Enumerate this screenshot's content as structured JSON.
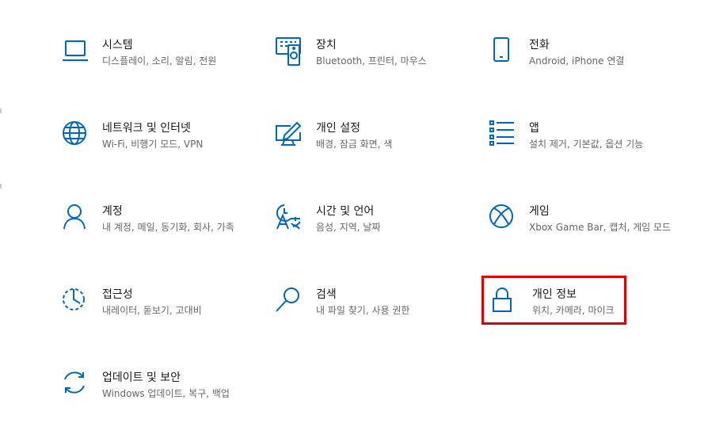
{
  "accent": "#0067c0",
  "highlight_color": "#e00000",
  "tiles": [
    {
      "title": "시스템",
      "desc": "디스플레이, 소리, 알림, 전원",
      "icon": "laptop-icon"
    },
    {
      "title": "장치",
      "desc": "Bluetooth, 프린터, 마우스",
      "icon": "devices-icon"
    },
    {
      "title": "전화",
      "desc": "Android, iPhone 연결",
      "icon": "phone-icon"
    },
    {
      "title": "네트워크 및 인터넷",
      "desc": "Wi-Fi, 비행기 모드, VPN",
      "icon": "globe-icon"
    },
    {
      "title": "개인 설정",
      "desc": "배경, 잠금 화면, 색",
      "icon": "personalization-icon"
    },
    {
      "title": "앱",
      "desc": "설치 제거, 기본값, 옵션 기능",
      "icon": "apps-list-icon"
    },
    {
      "title": "계정",
      "desc": "내 계정, 메일, 동기화, 회사, 가족",
      "icon": "person-icon"
    },
    {
      "title": "시간 및 언어",
      "desc": "음성, 지역, 날짜",
      "icon": "time-language-icon"
    },
    {
      "title": "게임",
      "desc": "Xbox Game Bar, 캡처, 게임 모드",
      "icon": "xbox-icon"
    },
    {
      "title": "접근성",
      "desc": "내레이터, 돋보기, 고대비",
      "icon": "accessibility-timer-icon"
    },
    {
      "title": "검색",
      "desc": "내 파일 찾기, 사용 권한",
      "icon": "search-icon"
    },
    {
      "title": "개인 정보",
      "desc": "위치, 카메라, 마이크",
      "icon": "lock-icon"
    },
    {
      "title": "업데이트 및 보안",
      "desc": "Windows 업데이트, 복구, 백업",
      "icon": "sync-icon"
    }
  ]
}
